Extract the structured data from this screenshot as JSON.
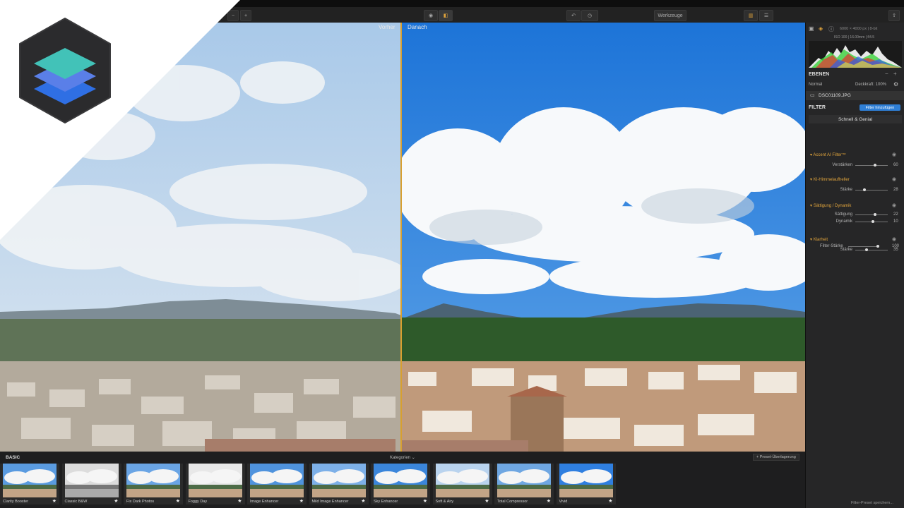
{
  "toolbar": {
    "tools_label": "Werkzeuge"
  },
  "canvas": {
    "before_label": "Vorher",
    "after_label": "Danach"
  },
  "sidebar": {
    "image_info": "ISO 100 | 16.00mm | f/4.5",
    "image_dims": "6000 × 4000 px | 8-bit",
    "layers_title": "EBENEN",
    "blend_mode": "Normal",
    "opacity": "Deckkraft: 100%",
    "filename": "DSC01109.JPG",
    "filter_title": "FILTER",
    "add_filter": "Filter hinzufügen",
    "preset_group": "Schnell & Genial",
    "filters": [
      {
        "name": "Accent AI Filter™",
        "sliders": [
          {
            "label": "Verstärken",
            "value": "60",
            "level": 0.6
          }
        ]
      },
      {
        "name": "KI-Himmelaufheller",
        "sliders": [
          {
            "label": "Stärke",
            "value": "28",
            "level": 0.28
          }
        ]
      },
      {
        "name": "Sättigung / Dynamik",
        "sliders": [
          {
            "label": "Sättigung",
            "value": "22",
            "level": 0.61
          },
          {
            "label": "Dynamik",
            "value": "10",
            "level": 0.55
          }
        ]
      },
      {
        "name": "Klarheit",
        "sliders": [
          {
            "label": "Stärke",
            "value": "35",
            "level": 0.35
          }
        ]
      }
    ],
    "filter_strength_label": "Filter-Stärke",
    "filter_strength_value": "100",
    "save_preset": "Filter-Preset speichern..."
  },
  "bottom": {
    "category": "BASIC",
    "categories_dropdown": "Kategorien",
    "preset_overlay": "+ Preset-Überlagerung",
    "presets": [
      "Clarity Booster",
      "Classic B&W",
      "Fix Dark Photos",
      "Foggy Day",
      "Image Enhancer",
      "Mild Image Enhancer",
      "Sky Enhancer",
      "Soft & Airy",
      "Total Compressor",
      "Vivid"
    ]
  },
  "colors": {
    "accent": "#e0a43c",
    "button_blue": "#2f7fd6",
    "divider": "#d8a030"
  }
}
